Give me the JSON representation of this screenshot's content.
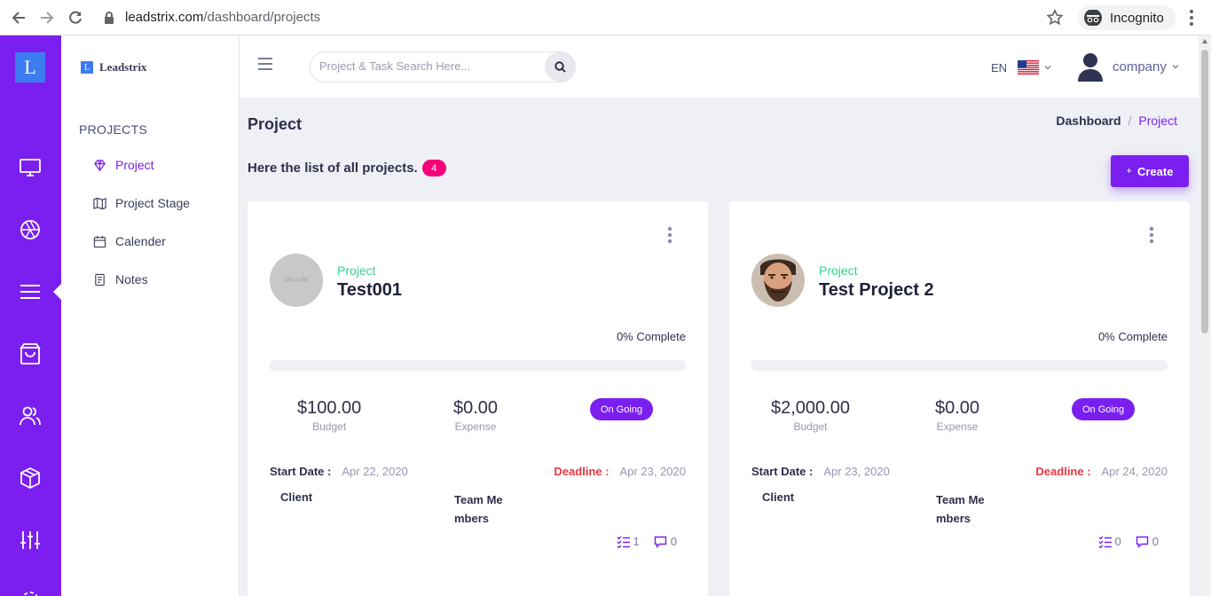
{
  "browser": {
    "url_host": "leadstrix.com",
    "url_path": "/dashboard/projects",
    "incognito_label": "Incognito"
  },
  "rail": {
    "logo_letter": "L"
  },
  "subnav": {
    "brand_letter": "L",
    "brand_name": "Leadstrix",
    "heading": "PROJECTS",
    "items": [
      {
        "label": "Project",
        "icon": "diamond-icon",
        "active": true
      },
      {
        "label": "Project Stage",
        "icon": "map-icon",
        "active": false
      },
      {
        "label": "Calender",
        "icon": "calendar-icon",
        "active": false
      },
      {
        "label": "Notes",
        "icon": "notes-icon",
        "active": false
      }
    ]
  },
  "header": {
    "search_placeholder": "Project & Task Search Here...",
    "language": "EN",
    "user_name": "company"
  },
  "main": {
    "page_title": "Project",
    "breadcrumb": {
      "home": "Dashboard",
      "separator": "/",
      "current": "Project"
    },
    "list_title": "Here the list of all projects.",
    "project_count": "4",
    "create_plus": "+",
    "create_label": "Create"
  },
  "projects": [
    {
      "label": "Project",
      "name": "Test001",
      "avatar_text": "150 x 150",
      "complete": "0% Complete",
      "progress": 0,
      "budget": "$100.00",
      "budget_label": "Budget",
      "expense": "$0.00",
      "expense_label": "Expense",
      "status": "On Going",
      "start_label": "Start Date :",
      "start_date": "Apr 22, 2020",
      "deadline_label": "Deadline :",
      "deadline": "Apr 23, 2020",
      "client_label": "Client",
      "team_label": "Team Members",
      "tasks": "1",
      "comments": "0"
    },
    {
      "label": "Project",
      "name": "Test Project 2",
      "avatar_text": "",
      "complete": "0% Complete",
      "progress": 0,
      "budget": "$2,000.00",
      "budget_label": "Budget",
      "expense": "$0.00",
      "expense_label": "Expense",
      "status": "On Going",
      "start_label": "Start Date :",
      "start_date": "Apr 23, 2020",
      "deadline_label": "Deadline :",
      "deadline": "Apr 24, 2020",
      "client_label": "Client",
      "team_label": "Team Members",
      "tasks": "0",
      "comments": "0"
    }
  ],
  "colors": {
    "accent": "#7a1ff0",
    "success": "#36d38a",
    "danger": "#e8383d",
    "badge": "#f7007a"
  }
}
